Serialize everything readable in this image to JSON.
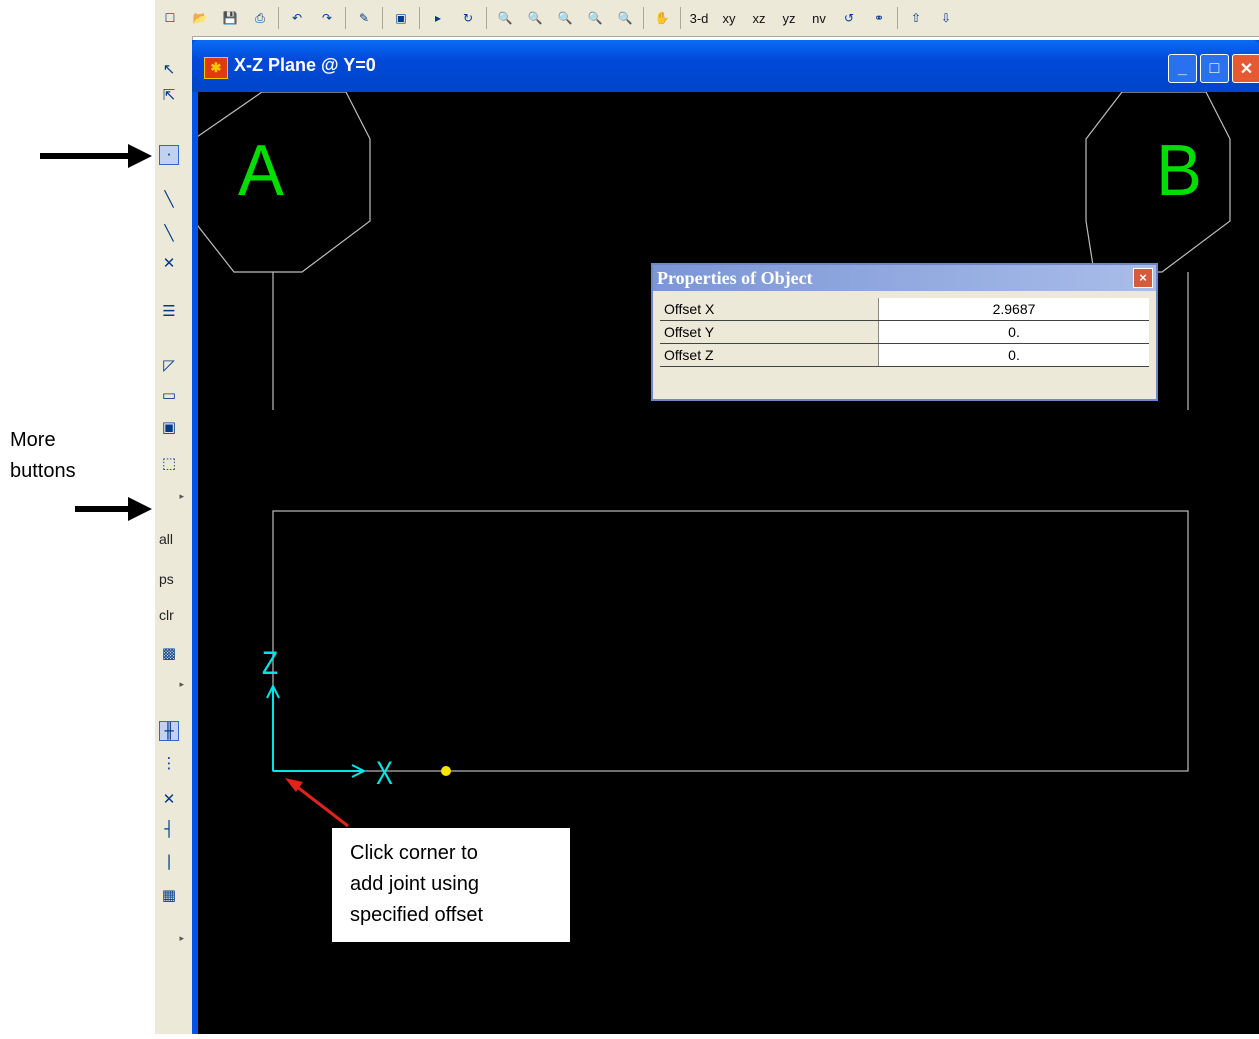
{
  "toolbar": {
    "view_labels": [
      "3-d",
      "xy",
      "xz",
      "yz",
      "nv"
    ]
  },
  "left_toolbar": {
    "text_buttons": [
      "all",
      "ps",
      "clr"
    ]
  },
  "window": {
    "title": "X-Z Plane @ Y=0",
    "minimize_glyph": "_",
    "maximize_glyph": "□",
    "close_glyph": "✕"
  },
  "canvas": {
    "grid_labels": [
      "A",
      "B"
    ],
    "axis_labels": {
      "z": "Z",
      "x": "X"
    }
  },
  "properties_dialog": {
    "title": "Properties of Object",
    "close_glyph": "×",
    "rows": [
      {
        "label": "Offset X",
        "value": "2.9687"
      },
      {
        "label": "Offset Y",
        "value": "0."
      },
      {
        "label": "Offset Z",
        "value": "0."
      }
    ]
  },
  "annotations": {
    "more_buttons_line1": "More",
    "more_buttons_line2": "buttons",
    "callout_line1": "Click corner to",
    "callout_line2": "add joint using",
    "callout_line3": "specified offset"
  },
  "colors": {
    "canvas_bg": "#000000",
    "grid_label_green": "#00dd00",
    "axis_cyan": "#00e5e5",
    "joint_yellow": "#f7e400",
    "callout_arrow_red": "#e0241b",
    "window_blue": "#0054e3"
  }
}
